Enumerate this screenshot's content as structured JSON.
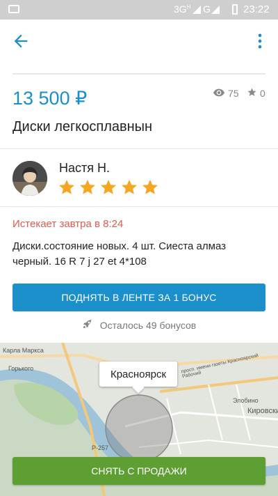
{
  "statusbar": {
    "network": "3G",
    "network_sub": "H",
    "carrier2": "G",
    "time": "23:22"
  },
  "listing": {
    "price": "13 500 ₽",
    "views": "75",
    "favorites": "0",
    "title": "Диски легкосплавнын",
    "expires": "Истекает завтра в 8:24",
    "description": "Диски.состояние новых. 4 шт. Сиеста алмаз черный. 16 R 7 j 27 et 4*108"
  },
  "seller": {
    "name": "Настя Н.",
    "rating": 5,
    "rating_max": 5
  },
  "actions": {
    "raise_label": "ПОДНЯТЬ В ЛЕНТЕ ЗА 1 БОНУС",
    "bonus_left": "Осталось 49 бонусов",
    "remove_label": "СНЯТЬ С ПРОДАЖИ"
  },
  "map": {
    "city": "Красноярск",
    "labels": [
      "Кировский",
      "Элобино",
      "Горького",
      "Карла Маркса",
      "Р-257",
      "просп. имени газеты Красноярский Рабочий"
    ]
  },
  "icons": {
    "back": "arrow-left-icon",
    "more": "more-vert-icon",
    "views": "eye-icon",
    "favorites": "star-icon",
    "rocket": "rocket-icon"
  },
  "colors": {
    "accent": "#1b8fc9",
    "success": "#5e9f33",
    "warning_text": "#e05a4f",
    "star": "#f5a623"
  }
}
